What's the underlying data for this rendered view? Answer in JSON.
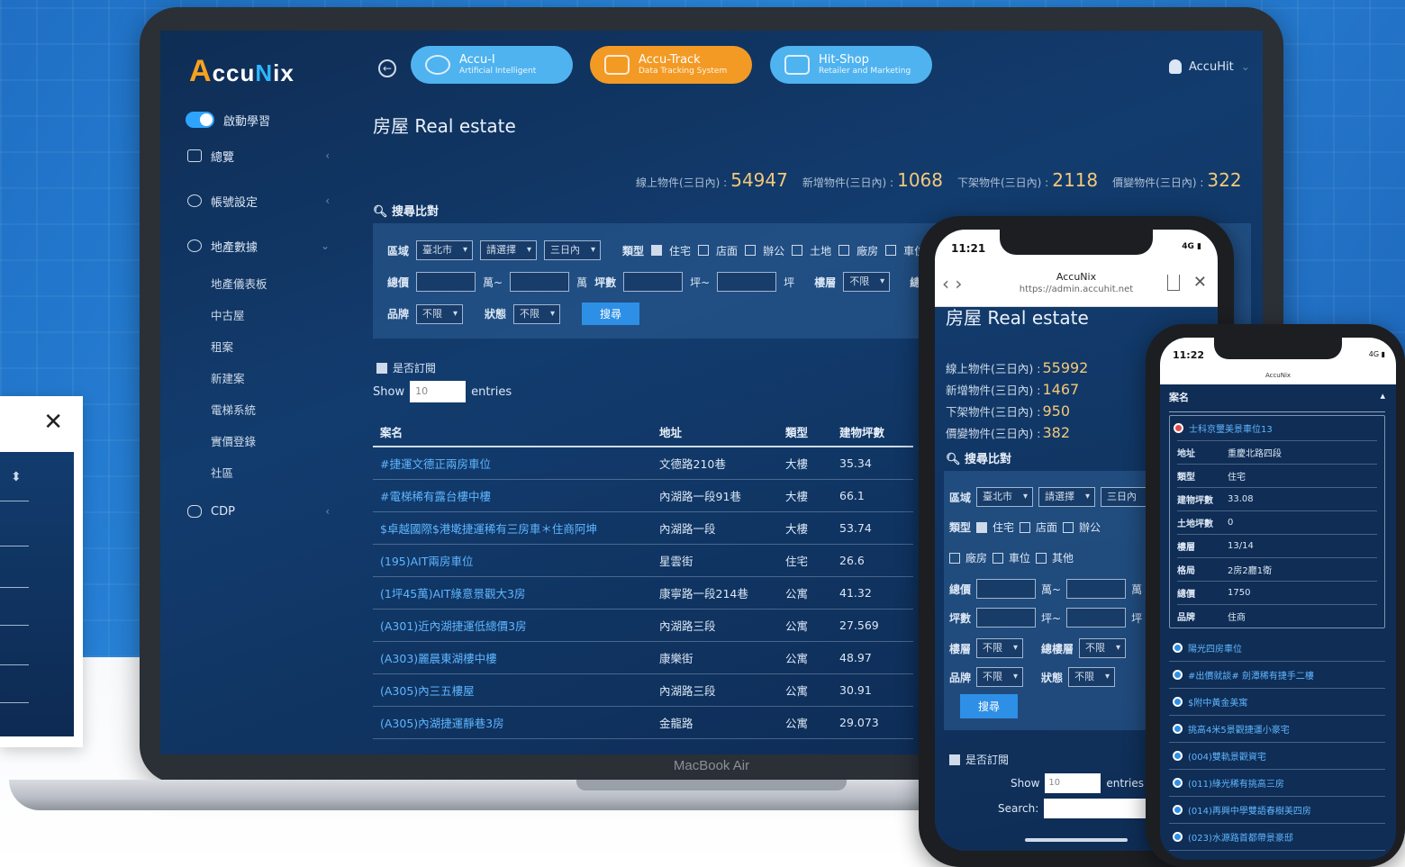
{
  "logo": {
    "text": "AccuNix"
  },
  "top_nav": {
    "pills": [
      {
        "title": "Accu-I",
        "subtitle": "Artificial Intelligent"
      },
      {
        "title": "Accu-Track",
        "subtitle": "Data Tracking System"
      },
      {
        "title": "Hit-Shop",
        "subtitle": "Retailer and Marketing"
      }
    ],
    "user": "AccuHit"
  },
  "sidebar": {
    "toggle_label": "啟動學習",
    "items": [
      {
        "label": "總覽"
      },
      {
        "label": "帳號設定"
      },
      {
        "label": "地產數據"
      }
    ],
    "sub_items": [
      "地產儀表板",
      "中古屋",
      "租案",
      "新建案",
      "電梯系統",
      "實價登錄",
      "社區"
    ],
    "cdp": "CDP"
  },
  "main": {
    "title": "房屋 Real estate",
    "stats": [
      {
        "label": "線上物件(三日內) :",
        "value": "54947"
      },
      {
        "label": "新增物件(三日內) :",
        "value": "1068"
      },
      {
        "label": "下架物件(三日內) :",
        "value": "2118"
      },
      {
        "label": "價變物件(三日內) :",
        "value": "322"
      }
    ],
    "search_heading": "搜尋比對",
    "filters": {
      "area_label": "區域",
      "area_city": "臺北市",
      "area_select": "請選擇",
      "area_days": "三日內",
      "type_label": "類型",
      "types": [
        "住宅",
        "店面",
        "辦公",
        "土地",
        "廠房",
        "車位"
      ],
      "price_label": "總價",
      "unit_wan": "萬",
      "wan_tilde": "萬~",
      "ping_label": "坪數",
      "ping_tilde": "坪~",
      "ping_unit": "坪",
      "floor_label": "樓層",
      "floor_value": "不限",
      "total_floor_label": "總樓",
      "brand_label": "品牌",
      "brand_value": "不限",
      "status_label": "狀態",
      "status_value": "不限",
      "search_button": "搜尋"
    },
    "subscribe": "是否訂閱",
    "show_label": "Show",
    "show_value": "10",
    "entries_label": "entries",
    "table": {
      "headers": [
        "案名",
        "地址",
        "類型",
        "建物坪數"
      ],
      "rows": [
        [
          "#捷運文德正兩房車位",
          "文德路210巷",
          "大樓",
          "35.34"
        ],
        [
          "#電梯稀有露台樓中樓",
          "內湖路一段91巷",
          "大樓",
          "66.1"
        ],
        [
          "$卓越國際$港墘捷運稀有三房車＊住商阿坤",
          "內湖路一段",
          "大樓",
          "53.74"
        ],
        [
          "(195)AIT兩房車位",
          "星雲街",
          "住宅",
          "26.6"
        ],
        [
          "(1坪45萬)AIT綠意景觀大3房",
          "康寧路一段214巷",
          "公寓",
          "41.32"
        ],
        [
          "(A301)近內湖捷運低總價3房",
          "內湖路三段",
          "公寓",
          "27.569"
        ],
        [
          "(A303)麗晨東湖樓中樓",
          "康樂街",
          "公寓",
          "48.97"
        ],
        [
          "(A305)內三五樓屋",
          "內湖路三段",
          "公寓",
          "30.91"
        ],
        [
          "(A305)內湖捷運靜巷3房",
          "金龍路",
          "公寓",
          "29.073"
        ]
      ]
    }
  },
  "laptop_label": "MacBook Air",
  "phone1": {
    "time": "11:21",
    "signal": "4G",
    "app": "AccuNix",
    "url": "https://admin.accuhit.net",
    "title": "房屋 Real estate",
    "stats": [
      {
        "label": "線上物件(三日內) :",
        "value": "55992"
      },
      {
        "label": "新增物件(三日內) :",
        "value": "1467"
      },
      {
        "label": "下架物件(三日內) :",
        "value": "950"
      },
      {
        "label": "價變物件(三日內) :",
        "value": "382"
      }
    ],
    "search_heading": "搜尋比對",
    "types_row1": [
      "住宅",
      "店面",
      "辦公"
    ],
    "types_row2": [
      "廠房",
      "車位",
      "其他"
    ],
    "total_floor_label": "總樓層",
    "search_label": "Search:"
  },
  "phone2": {
    "time": "11:22",
    "signal": "4G",
    "app": "AccuNix",
    "header": "案名",
    "first_item": "士科京璽美景車位13",
    "details": [
      {
        "k": "地址",
        "v": "重慶北路四段"
      },
      {
        "k": "類型",
        "v": "住宅"
      },
      {
        "k": "建物坪數",
        "v": "33.08"
      },
      {
        "k": "土地坪數",
        "v": "0"
      },
      {
        "k": "樓層",
        "v": "13/14"
      },
      {
        "k": "格局",
        "v": "2房2廳1衛"
      },
      {
        "k": "總價",
        "v": "1750"
      },
      {
        "k": "品牌",
        "v": "住商"
      }
    ],
    "list": [
      "陽光四房車位",
      "#出價就談# 劍潭稀有捷手二樓",
      "$附中黃金美寓",
      "挑高4米5景觀捷運小豪宅",
      "(004)雙軌景觀資宅",
      "(011)綠光稀有挑高三房",
      "(014)再興中學雙語春樹美四房",
      "(023)水源路首都帶景豪邸"
    ]
  }
}
